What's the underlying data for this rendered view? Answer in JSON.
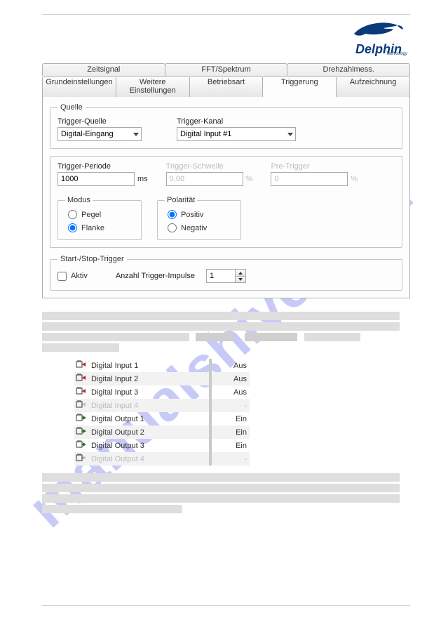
{
  "logo": {
    "brand": "Delphin",
    "sub": "Technology"
  },
  "tabs": {
    "row1": [
      "Zeitsignal",
      "FFT/Spektrum",
      "Drehzahlmess."
    ],
    "row2": [
      "Grundeinstellungen",
      "Weitere Einstellungen",
      "Betriebsart",
      "Triggerung",
      "Aufzeichnung"
    ],
    "active": "Triggerung"
  },
  "groups": {
    "quelle": "Quelle",
    "modus": "Modus",
    "polaritaet": "Polarität",
    "startstop": "Start-/Stop-Trigger"
  },
  "quelle": {
    "trigger_quelle_label": "Trigger-Quelle",
    "trigger_quelle_value": "Digital-Eingang",
    "trigger_kanal_label": "Trigger-Kanal",
    "trigger_kanal_value": "Digital Input #1"
  },
  "periode": {
    "label": "Trigger-Periode",
    "value": "1000",
    "unit": "ms"
  },
  "schwelle": {
    "label": "Trigger-Schwelle",
    "value": "0,00",
    "unit": "%"
  },
  "pre": {
    "label": "Pre-Trigger",
    "value": "0",
    "unit": "%"
  },
  "modus": {
    "pegel": "Pegel",
    "flanke": "Flanke",
    "selected": "flanke"
  },
  "polaritaet": {
    "positiv": "Positiv",
    "negativ": "Negativ",
    "selected": "positiv"
  },
  "startstop": {
    "aktiv": "Aktiv",
    "aktiv_checked": false,
    "impulse_label": "Anzahl Trigger-Impulse",
    "impulse_value": "1"
  },
  "io": [
    {
      "name": "Digital Input 1",
      "value": "Aus",
      "active": true,
      "dir": "in"
    },
    {
      "name": "Digital Input 2",
      "value": "Aus",
      "active": true,
      "dir": "in"
    },
    {
      "name": "Digital Input 3",
      "value": "Aus",
      "active": true,
      "dir": "in"
    },
    {
      "name": "Digital Input 4",
      "value": "-",
      "active": false,
      "dir": "in"
    },
    {
      "name": "Digital Output 1",
      "value": "Ein",
      "active": true,
      "dir": "out"
    },
    {
      "name": "Digital Output 2",
      "value": "Ein",
      "active": true,
      "dir": "out"
    },
    {
      "name": "Digital Output 3",
      "value": "Ein",
      "active": true,
      "dir": "out"
    },
    {
      "name": "Digital Output 4",
      "value": "-",
      "active": false,
      "dir": "out"
    }
  ],
  "watermark": "manualshive.com"
}
